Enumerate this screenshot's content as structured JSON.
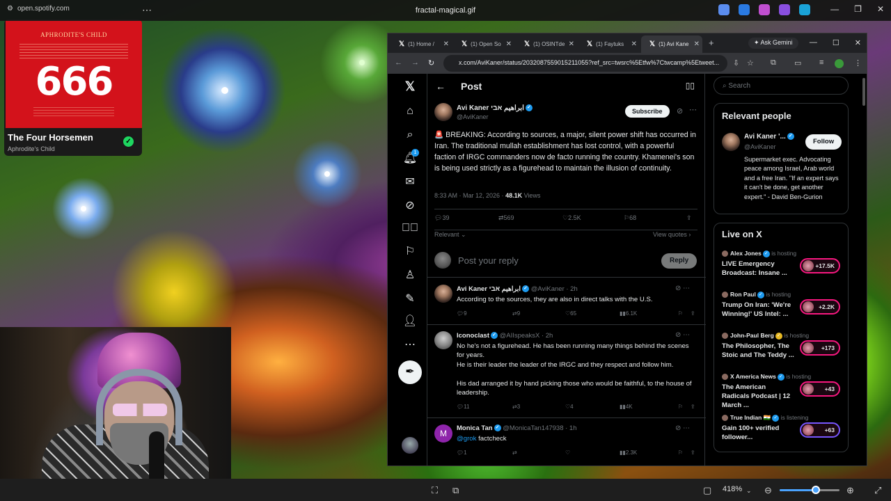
{
  "topbar": {
    "url_chip": "open.spotify.com",
    "dots": "⋯",
    "window_title": "fractal-magical.gif",
    "controls": [
      "—",
      "❐",
      "✕"
    ]
  },
  "spotify": {
    "band": "APHRODITE'S CHILD",
    "album_number": "666",
    "track": "The Four Horsemen",
    "artist": "Aphrodite's Child",
    "check": "✓"
  },
  "statusbar": {
    "zoom": "418%",
    "zoom_fraction": 0.6
  },
  "browser": {
    "tabs": [
      {
        "label": "(1) Home /"
      },
      {
        "label": "(1) Open So"
      },
      {
        "label": "(1) OSINTde"
      },
      {
        "label": "(1) Faytuks"
      },
      {
        "label": "(1) Avi Kane"
      }
    ],
    "tab_logo": "𝕏",
    "tab_close": "✕",
    "new_tab": "+",
    "ask_gemini": "✦ Ask Gemini",
    "window_controls": [
      "—",
      "☐",
      "✕"
    ],
    "url": "x.com/AviKaner/status/2032087559015211055?ref_src=twsrc%5Etfw%7Ctwcamp%5Etweet..."
  },
  "x": {
    "nav_logo": "𝕏",
    "notification_count": "1",
    "header_title": "Post",
    "header_back": "←",
    "main_post": {
      "name": "Avi Kaner ابراهیم אבי",
      "handle": "@AviKaner",
      "subscribe": "Subscribe",
      "text": "🚨 BREAKING: According to sources, a major, silent power shift has occurred in Iran. The traditional mullah establishment has lost control, with a powerful faction of IRGC commanders now de facto running the country. Khamenei's son is being used strictly as a figurehead to maintain the illusion of continuity.",
      "time": "8:33 AM · Mar 12, 2026 · ",
      "views_count": "48.1K",
      "views_label": " Views",
      "replies": "39",
      "reposts": "569",
      "likes": "2.5K",
      "bookmarks": "68",
      "relevant": "Relevant ⌄",
      "view_quotes": "View quotes ›"
    },
    "reply_box": {
      "placeholder": "Post your reply",
      "button": "Reply"
    },
    "replies": [
      {
        "name": "Avi Kaner ابراهیم אבי",
        "handle": "@AviKaner · 2h",
        "text": "According to the sources, they are also in direct talks with the U.S.",
        "replies": "9",
        "reposts": "9",
        "likes": "65",
        "views": "6.1K"
      },
      {
        "name": "Iconoclast",
        "handle": "@AIIspeaksX · 2h",
        "text1": "No he's not a figurehead. He has been running many things behind the scenes for years.",
        "text2": "He is their leader the leader of the IRGC and they respect and follow him.",
        "text3": "His dad arranged it by hand picking those who would be faithful, to the house of leadership.",
        "replies": "11",
        "reposts": "3",
        "likes": "4",
        "views": "4K"
      },
      {
        "name": "Monica Tan",
        "handle": "@MonicaTan147938 · 1h",
        "mention": "@grok",
        "text": " factcheck",
        "replies": "1",
        "reposts": "",
        "likes": "",
        "views": "2.3K"
      }
    ],
    "sidebar": {
      "search_placeholder": "Search",
      "relevant_title": "Relevant people",
      "rp_name": "Avi Kaner '...",
      "rp_handle": "@AviKaner",
      "rp_follow": "Follow",
      "rp_bio": "Supermarket exec. Advocating peace among Israel, Arab world and a free Iran. \"If an expert says it can't be done, get another expert.\" - David Ben-Gurion",
      "live_title": "Live on X",
      "live": [
        {
          "host": "Alex Jones",
          "status": " is hosting",
          "title": "LIVE Emergency Broadcast: Insane ...",
          "count": "+17.5K"
        },
        {
          "host": "Ron Paul",
          "status": " is hosting",
          "title": "Trump On Iran: 'We're Winning!' US Intel: ...",
          "count": "+2.2K"
        },
        {
          "host": "John-Paul Berg",
          "status": " is hosting",
          "title": "The Philosopher, The Stoic and The Teddy ...",
          "count": "+173"
        },
        {
          "host": "X America News",
          "status": " is hosting",
          "title": "The American Radicals Podcast | 12 March ...",
          "count": "+43"
        },
        {
          "host": "True Indian 🇮🇳",
          "status": " is listening",
          "title": "Gain 100+ verified follower...",
          "count": "+63"
        }
      ]
    }
  }
}
